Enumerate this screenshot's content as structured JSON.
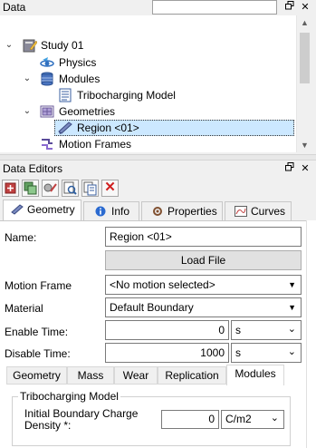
{
  "data_panel": {
    "title": "Data",
    "search_placeholder": "",
    "tree": [
      {
        "label": "Study 01",
        "icon": "study-icon",
        "expanded": true
      },
      {
        "label": "Physics",
        "icon": "physics-icon"
      },
      {
        "label": "Modules",
        "icon": "modules-icon",
        "expanded": true
      },
      {
        "label": "Tribocharging Model",
        "icon": "document-icon"
      },
      {
        "label": "Geometries",
        "icon": "geometries-icon",
        "expanded": true
      },
      {
        "label": "Region <01>",
        "icon": "region-icon",
        "selected": true
      },
      {
        "label": "Motion Frames",
        "icon": "motion-frames-icon"
      }
    ]
  },
  "editors_panel": {
    "title": "Data Editors",
    "toolbar_icons": [
      "add-icon",
      "duplicate-icon",
      "wizard-icon",
      "inspect-icon",
      "copy-icon",
      "delete-icon"
    ],
    "tabs": [
      "Geometry",
      "Info",
      "Properties",
      "Curves"
    ],
    "active_tab": "Geometry",
    "form": {
      "name_label": "Name:",
      "name_value": "Region <01>",
      "load_file_label": "Load File",
      "motion_frame_label": "Motion Frame",
      "motion_frame_value": "<No motion selected>",
      "material_label": "Material",
      "material_value": "Default Boundary",
      "enable_time_label": "Enable Time:",
      "enable_time_value": "0",
      "enable_time_unit": "s",
      "disable_time_label": "Disable Time:",
      "disable_time_value": "1000",
      "disable_time_unit": "s"
    },
    "sub_tabs": [
      "Geometry",
      "Mass",
      "Wear",
      "Replication",
      "Modules"
    ],
    "active_sub_tab": "Modules",
    "tribocharging": {
      "group_title": "Tribocharging Model",
      "charge_label_line1": "Initial Boundary Charge",
      "charge_label_line2": "Density *:",
      "charge_value": "0",
      "charge_unit": "C/m2"
    }
  }
}
